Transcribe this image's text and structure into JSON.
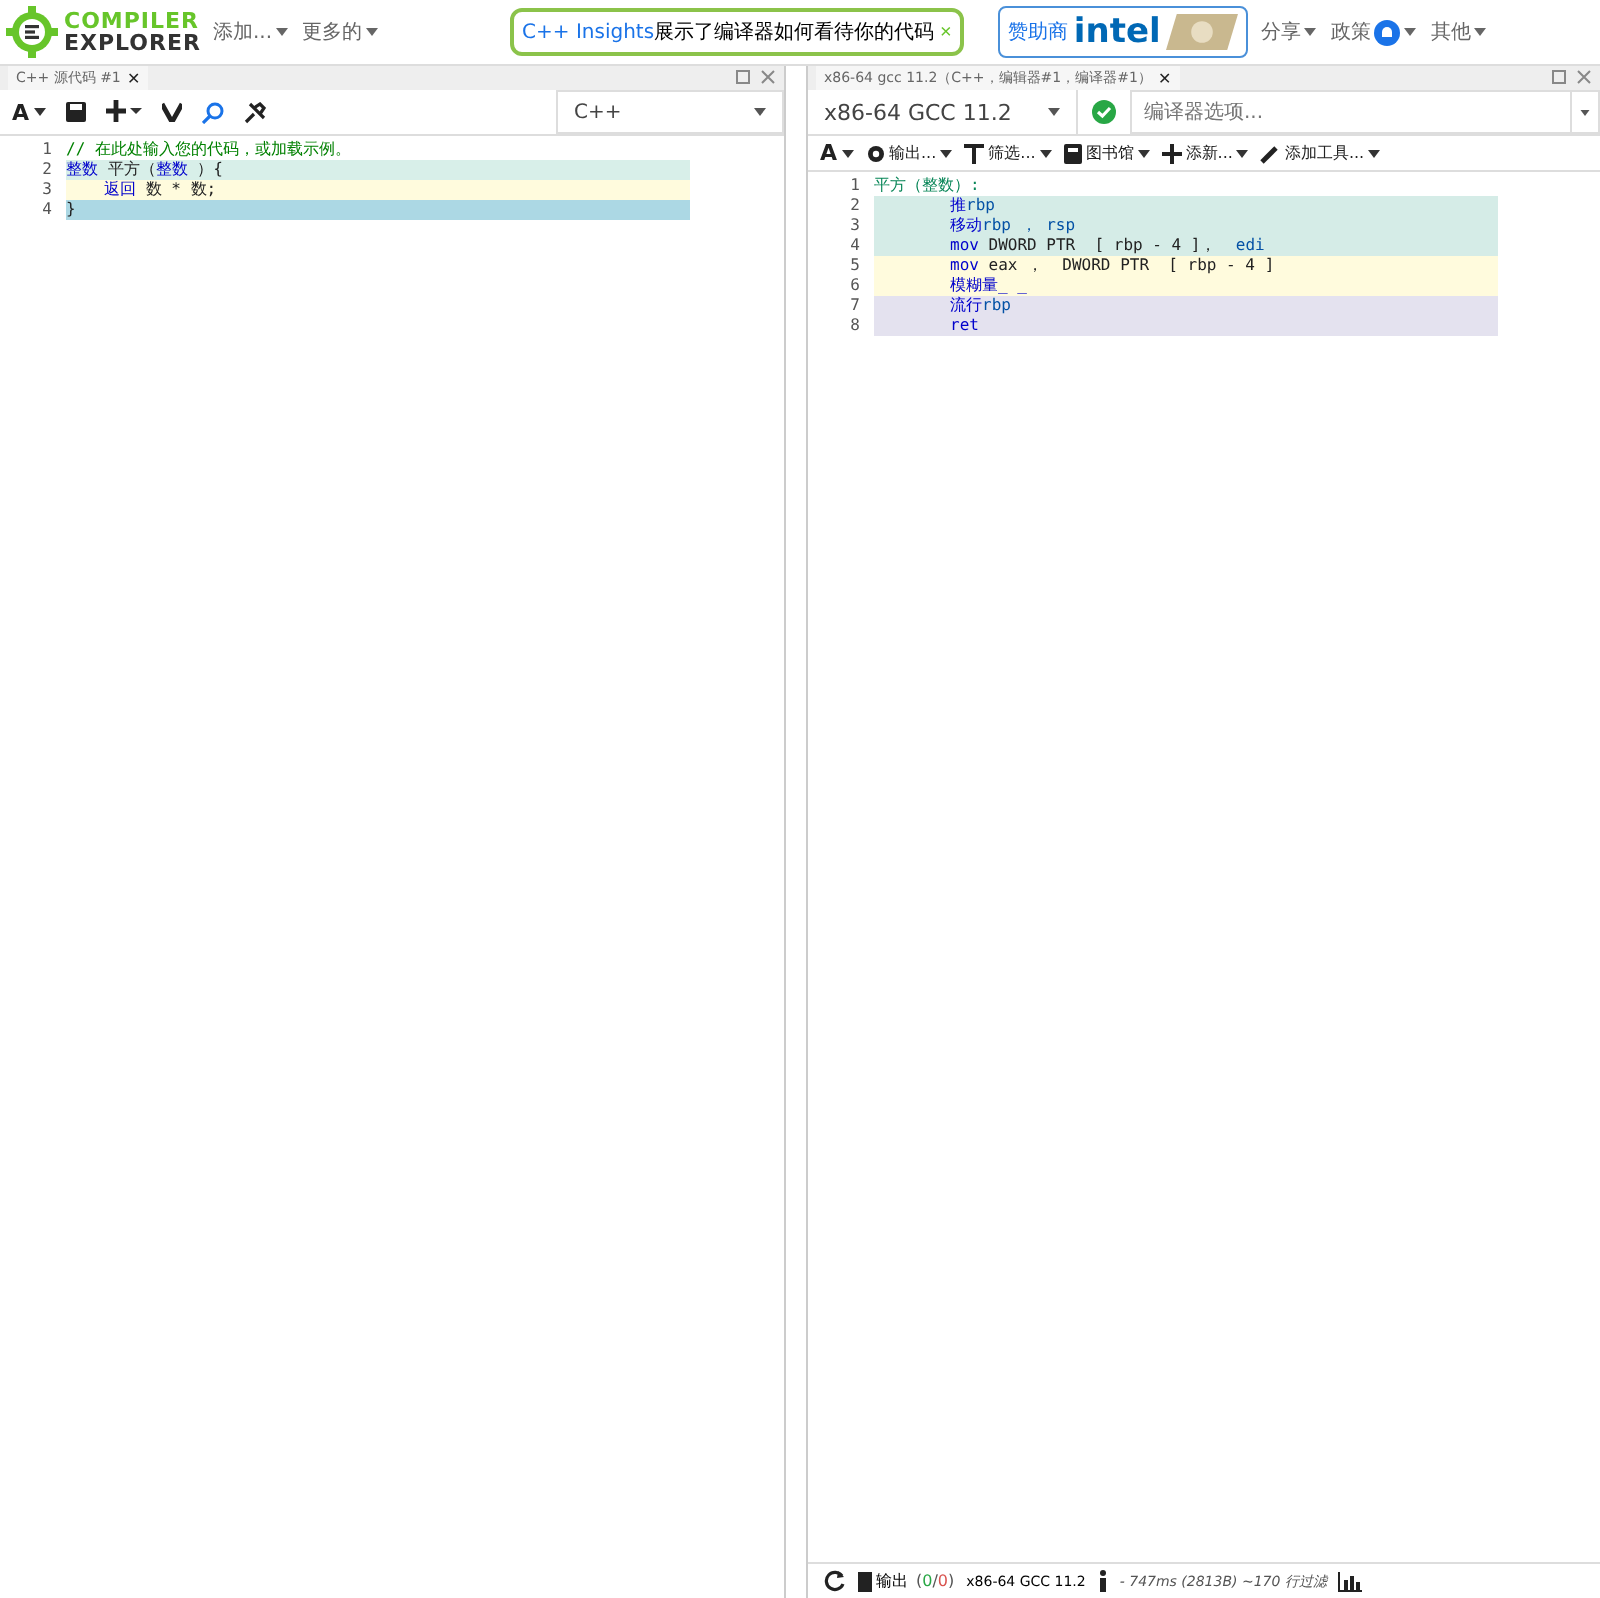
{
  "header": {
    "logo_top": "COMPILER",
    "logo_bottom": "EXPLORER",
    "menus": [
      "添加...",
      "更多的"
    ],
    "banner": {
      "link": "C++ Insights",
      "text": "展示了编译器如何看待你的代码",
      "close": "×"
    },
    "sponsor": {
      "label": "赞助商",
      "brand": "intel"
    },
    "right_menus": [
      {
        "label": "分享",
        "bell": false
      },
      {
        "label": "政策",
        "bell": true
      },
      {
        "label": "其他",
        "bell": false
      }
    ]
  },
  "editor": {
    "tab": "C++ 源代码 #1",
    "tab_close": "✕",
    "font_button": "A",
    "language": "C++",
    "lines": [
      {
        "num": "1",
        "color": "#ffffff",
        "indent": false,
        "segments": [
          {
            "kind": "comment",
            "text": "// 在此处输入您的代码，或加载示例。"
          }
        ]
      },
      {
        "num": "2",
        "color": "#d8efe9",
        "indent": false,
        "segments": [
          {
            "kind": "kw",
            "text": "整数"
          },
          {
            "kind": "text",
            "text": " 平方（"
          },
          {
            "kind": "kw",
            "text": "整数"
          },
          {
            "kind": "text",
            "text": " ）{"
          }
        ]
      },
      {
        "num": "3",
        "color": "#fffbdd",
        "indent": true,
        "segments": [
          {
            "kind": "kw",
            "text": "返回"
          },
          {
            "kind": "text",
            "text": " 数 * 数;"
          }
        ]
      },
      {
        "num": "4",
        "color": "#acd8e4",
        "indent": false,
        "segments": [
          {
            "kind": "text",
            "text": "}"
          }
        ]
      }
    ]
  },
  "compiler": {
    "tab": "x86-64 gcc 11.2（C++，编辑器#1，编译器#1）",
    "tab_close": "✕",
    "name": "x86-64 GCC 11.2",
    "options_placeholder": "编译器选项...",
    "font_button": "A",
    "tools": [
      {
        "kind": "gear",
        "label": "输出..."
      },
      {
        "kind": "filter",
        "label": "筛选..."
      },
      {
        "kind": "book",
        "label": "图书馆"
      },
      {
        "kind": "plus",
        "label": "添新..."
      },
      {
        "kind": "wrench",
        "label": "添加工具..."
      }
    ],
    "lines": [
      {
        "num": "1",
        "color": "#ffffff",
        "indent": false,
        "segments": [
          {
            "kind": "label",
            "text": "平方（整数）:"
          }
        ]
      },
      {
        "num": "2",
        "color": "#d5ece7",
        "indent": true,
        "segments": [
          {
            "kind": "kw",
            "text": "推"
          },
          {
            "kind": "reg",
            "text": "rbp"
          }
        ]
      },
      {
        "num": "3",
        "color": "#d5ece7",
        "indent": true,
        "segments": [
          {
            "kind": "kw",
            "text": "移动"
          },
          {
            "kind": "reg",
            "text": "rbp ， "
          },
          {
            "kind": "reg",
            "text": "rsp"
          }
        ]
      },
      {
        "num": "4",
        "color": "#d5ece7",
        "indent": true,
        "segments": [
          {
            "kind": "kw",
            "text": "mov"
          },
          {
            "kind": "text",
            "text": " DWORD PTR  [ rbp - 4 ]，  "
          },
          {
            "kind": "reg",
            "text": "edi"
          }
        ]
      },
      {
        "num": "5",
        "color": "#fffbdd",
        "indent": true,
        "segments": [
          {
            "kind": "kw",
            "text": "mov"
          },
          {
            "kind": "text",
            "text": " eax ，  DWORD PTR  [ rbp - 4 ]"
          }
        ]
      },
      {
        "num": "6",
        "color": "#fffbdd",
        "indent": true,
        "segments": [
          {
            "kind": "kw",
            "text": "模糊量_ _"
          }
        ]
      },
      {
        "num": "7",
        "color": "#e4e2ef",
        "indent": true,
        "segments": [
          {
            "kind": "kw",
            "text": "流行"
          },
          {
            "kind": "reg",
            "text": "rbp"
          }
        ]
      },
      {
        "num": "8",
        "color": "#e4e2ef",
        "indent": true,
        "segments": [
          {
            "kind": "kw",
            "text": "ret"
          }
        ]
      }
    ],
    "footer": {
      "output": "输出",
      "open": "(",
      "ok": "0",
      "sep": "/",
      "err": "0",
      "close": ")",
      "compiler": "x86-64 GCC 11.2",
      "stats": "- 747ms (2813B) ~170 行过滤"
    }
  }
}
